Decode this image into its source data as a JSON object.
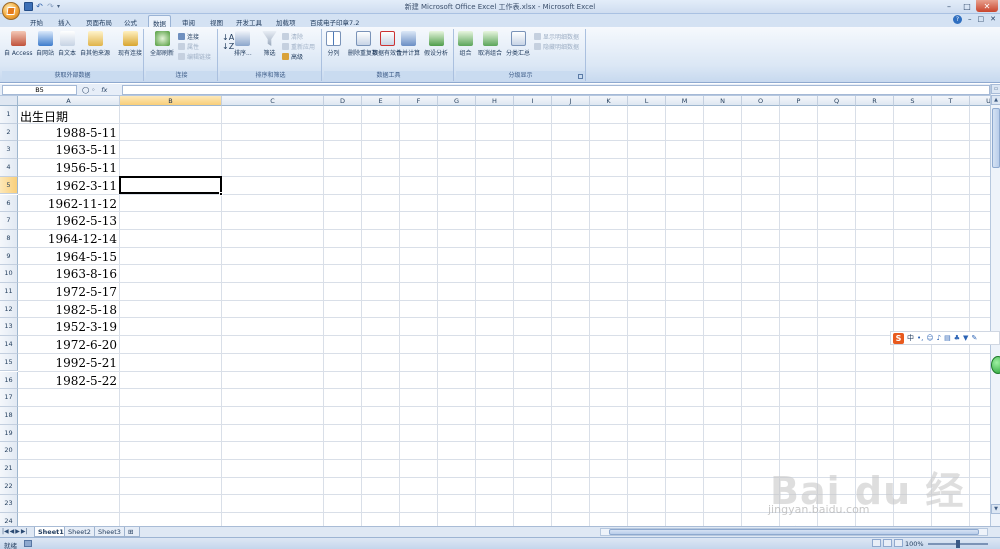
{
  "window": {
    "title": "新建 Microsoft Office Excel 工作表.xlsx - Microsoft Excel"
  },
  "tabs": [
    "开始",
    "插入",
    "页面布局",
    "公式",
    "数据",
    "审阅",
    "视图",
    "开发工具",
    "加载项",
    "百成电子印章7.2"
  ],
  "active_tab": "数据",
  "ribbon": {
    "groups": [
      {
        "label": "获取外部数据",
        "buttons": [
          "自 Access",
          "自网站",
          "自文本",
          "自其他来源",
          "现有连接"
        ]
      },
      {
        "label": "连接",
        "buttons": [
          "全部刷新"
        ],
        "small": [
          "连接",
          "属性",
          "编辑链接"
        ]
      },
      {
        "label": "排序和筛选",
        "buttons": [
          "排序...",
          "筛选"
        ],
        "small": [
          "清除",
          "重新应用",
          "高级"
        ]
      },
      {
        "label": "数据工具",
        "buttons": [
          "分列",
          "删除重复项",
          "数据有效性",
          "合并计算",
          "假设分析"
        ]
      },
      {
        "label": "分级显示",
        "buttons": [
          "组合",
          "取消组合",
          "分类汇总"
        ],
        "small": [
          "显示明细数据",
          "隐藏明细数据"
        ]
      }
    ]
  },
  "formula_bar": {
    "name_box": "B5",
    "fx": "fx",
    "value": ""
  },
  "columns": [
    "A",
    "B",
    "C",
    "D",
    "E",
    "F",
    "G",
    "H",
    "I",
    "J",
    "K",
    "L",
    "M",
    "N",
    "O",
    "P",
    "Q",
    "R",
    "S",
    "T",
    "U"
  ],
  "rows": [
    "1",
    "2",
    "3",
    "4",
    "5",
    "6",
    "7",
    "8",
    "9",
    "10",
    "11",
    "12",
    "13",
    "14",
    "15",
    "16",
    "17",
    "18",
    "19",
    "20",
    "21",
    "22",
    "23",
    "24"
  ],
  "cells": {
    "header": "出生日期",
    "dates": [
      "1988-5-11",
      "1963-5-11",
      "1956-5-11",
      "1962-3-11",
      "1962-11-12",
      "1962-5-13",
      "1964-12-14",
      "1964-5-15",
      "1963-8-16",
      "1972-5-17",
      "1982-5-18",
      "1952-3-19",
      "1972-6-20",
      "1992-5-21",
      "1982-5-22"
    ]
  },
  "selection": {
    "cell": "B5",
    "column": "B",
    "row": "5"
  },
  "sheets": [
    "Sheet1",
    "Sheet2",
    "Sheet3"
  ],
  "active_sheet": "Sheet1",
  "status": {
    "ready": "就绪",
    "zoom": "100%"
  },
  "ime": {
    "logo": "S",
    "mode": "中"
  },
  "watermark": {
    "brand": "Bai du 经验",
    "url": "jingyan.baidu.com"
  },
  "colors": {
    "ribbon_bg": "#dbe7f5",
    "selection_header": "#f9cf7a",
    "active_cell_border": "#000000"
  }
}
